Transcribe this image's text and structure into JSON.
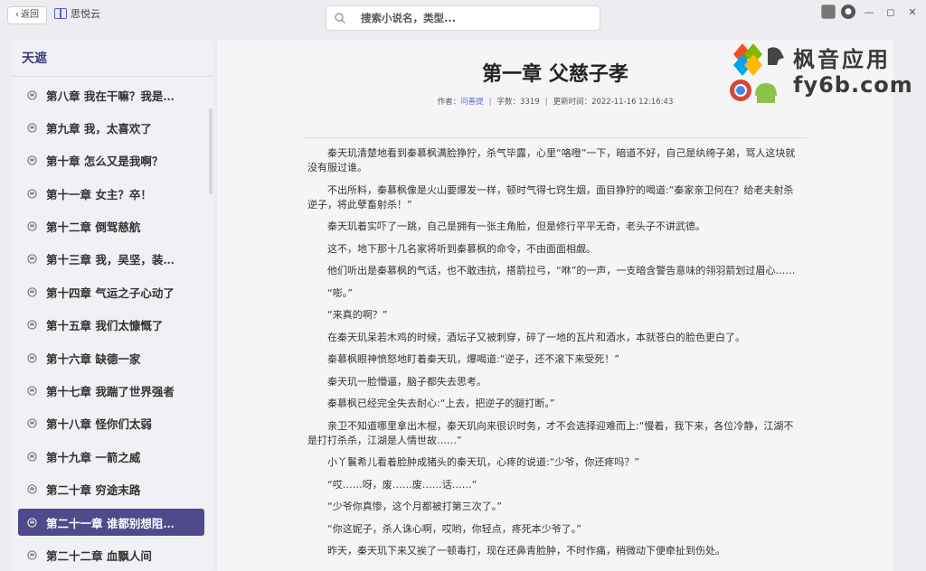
{
  "topbar": {
    "back_label": "返回",
    "app_name": "思悦云",
    "search_placeholder": "搜索小说名，类型..."
  },
  "sidebar": {
    "book_title": "天遮",
    "chapters": [
      {
        "label": "第八章 我在干嘛？我是…",
        "active": false
      },
      {
        "label": "第九章 我，太喜欢了",
        "active": false
      },
      {
        "label": "第十章 怎么又是我啊？",
        "active": false
      },
      {
        "label": "第十一章 女主？卒！",
        "active": false
      },
      {
        "label": "第十二章 倒驾慈航",
        "active": false
      },
      {
        "label": "第十三章 我，吴坚，装…",
        "active": false
      },
      {
        "label": "第十四章 气运之子心动了",
        "active": false
      },
      {
        "label": "第十五章 我们太慷慨了",
        "active": false
      },
      {
        "label": "第十六章 缺德一家",
        "active": false
      },
      {
        "label": "第十七章 我踹了世界强者",
        "active": false
      },
      {
        "label": "第十八章 怪你们太弱",
        "active": false
      },
      {
        "label": "第十九章 一箭之威",
        "active": false
      },
      {
        "label": "第二十章 穷途末路",
        "active": false
      },
      {
        "label": "第二十一章 谁都别想阻…",
        "active": true
      },
      {
        "label": "第二十二章 血飘人间",
        "active": false
      }
    ]
  },
  "reader": {
    "chapter_title": "第一章 父慈子孝",
    "author_label": "作者：",
    "author": "问善提",
    "word_count_label": "字数：",
    "word_count": "3319",
    "updated_label": "更新时间：",
    "updated_time": "2022-11-16 12:16:43",
    "paragraphs": [
      "秦天玑清楚地看到秦慕枫满脸狰狞，杀气毕露，心里“咯噔”一下，暗道不好，自己是纨绔子弟，骂人这块就没有服过谁。",
      "不出所料，秦慕枫像是火山要爆发一样，顿时气得七窍生烟，面目狰狞的喝道:“秦家亲卫何在？给老夫射杀逆子，将此孽畜射杀！”",
      "秦天玑着实吓了一跳，自己是拥有一张主角脸，但是修行平平无奇，老头子不讲武德。",
      "这不，地下那十几名家将听到秦慕枫的命令，不由面面相觑。",
      "他们听出是秦慕枫的气话，也不敢违抗，搭箭拉弓，“咻”的一声，一支暗含警告意味的翎羽箭划过眉心……",
      "“嘭。”",
      "“来真的啊？”",
      "在秦天玑呆若木鸡的时候，酒坛子又被刺穿，碎了一地的瓦片和酒水，本就苍白的脸色更白了。",
      "秦慕枫眼神愤怒地盯着秦天玑，爆喝道:“逆子，还不滚下来受死！”",
      "秦天玑一脸懵逼，脑子都失去思考。",
      "秦慕枫已经完全失去耐心:“上去，把逆子的腿打断。”",
      "亲卫不知道哪里拿出木棍，秦天玑向来很识时务，才不会选择迎难而上:“慢着，我下来，各位冷静，江湖不是打打杀杀，江湖是人情世故……”",
      "小丫鬟希儿看着脸肿成猪头的秦天玑，心疼的说道:“少爷，你还疼吗？”",
      "“哎……呀，废……废……话……”",
      "“少爷你真惨，这个月都被打第三次了。”",
      "“你这妮子，杀人诛心啊，哎哟，你轻点，疼死本少爷了。”",
      "昨天，秦天玑下来又挨了一顿毒打，现在还鼻青脸肿，不时作痛，稍微动下便牵扯到伤处。"
    ]
  },
  "watermark": {
    "cn": "枫音应用",
    "en": "fy6b.com"
  },
  "colors": {
    "accent": "#4f4a8c",
    "book_title": "#3d3a7a",
    "author_link": "#5a6fd0"
  }
}
